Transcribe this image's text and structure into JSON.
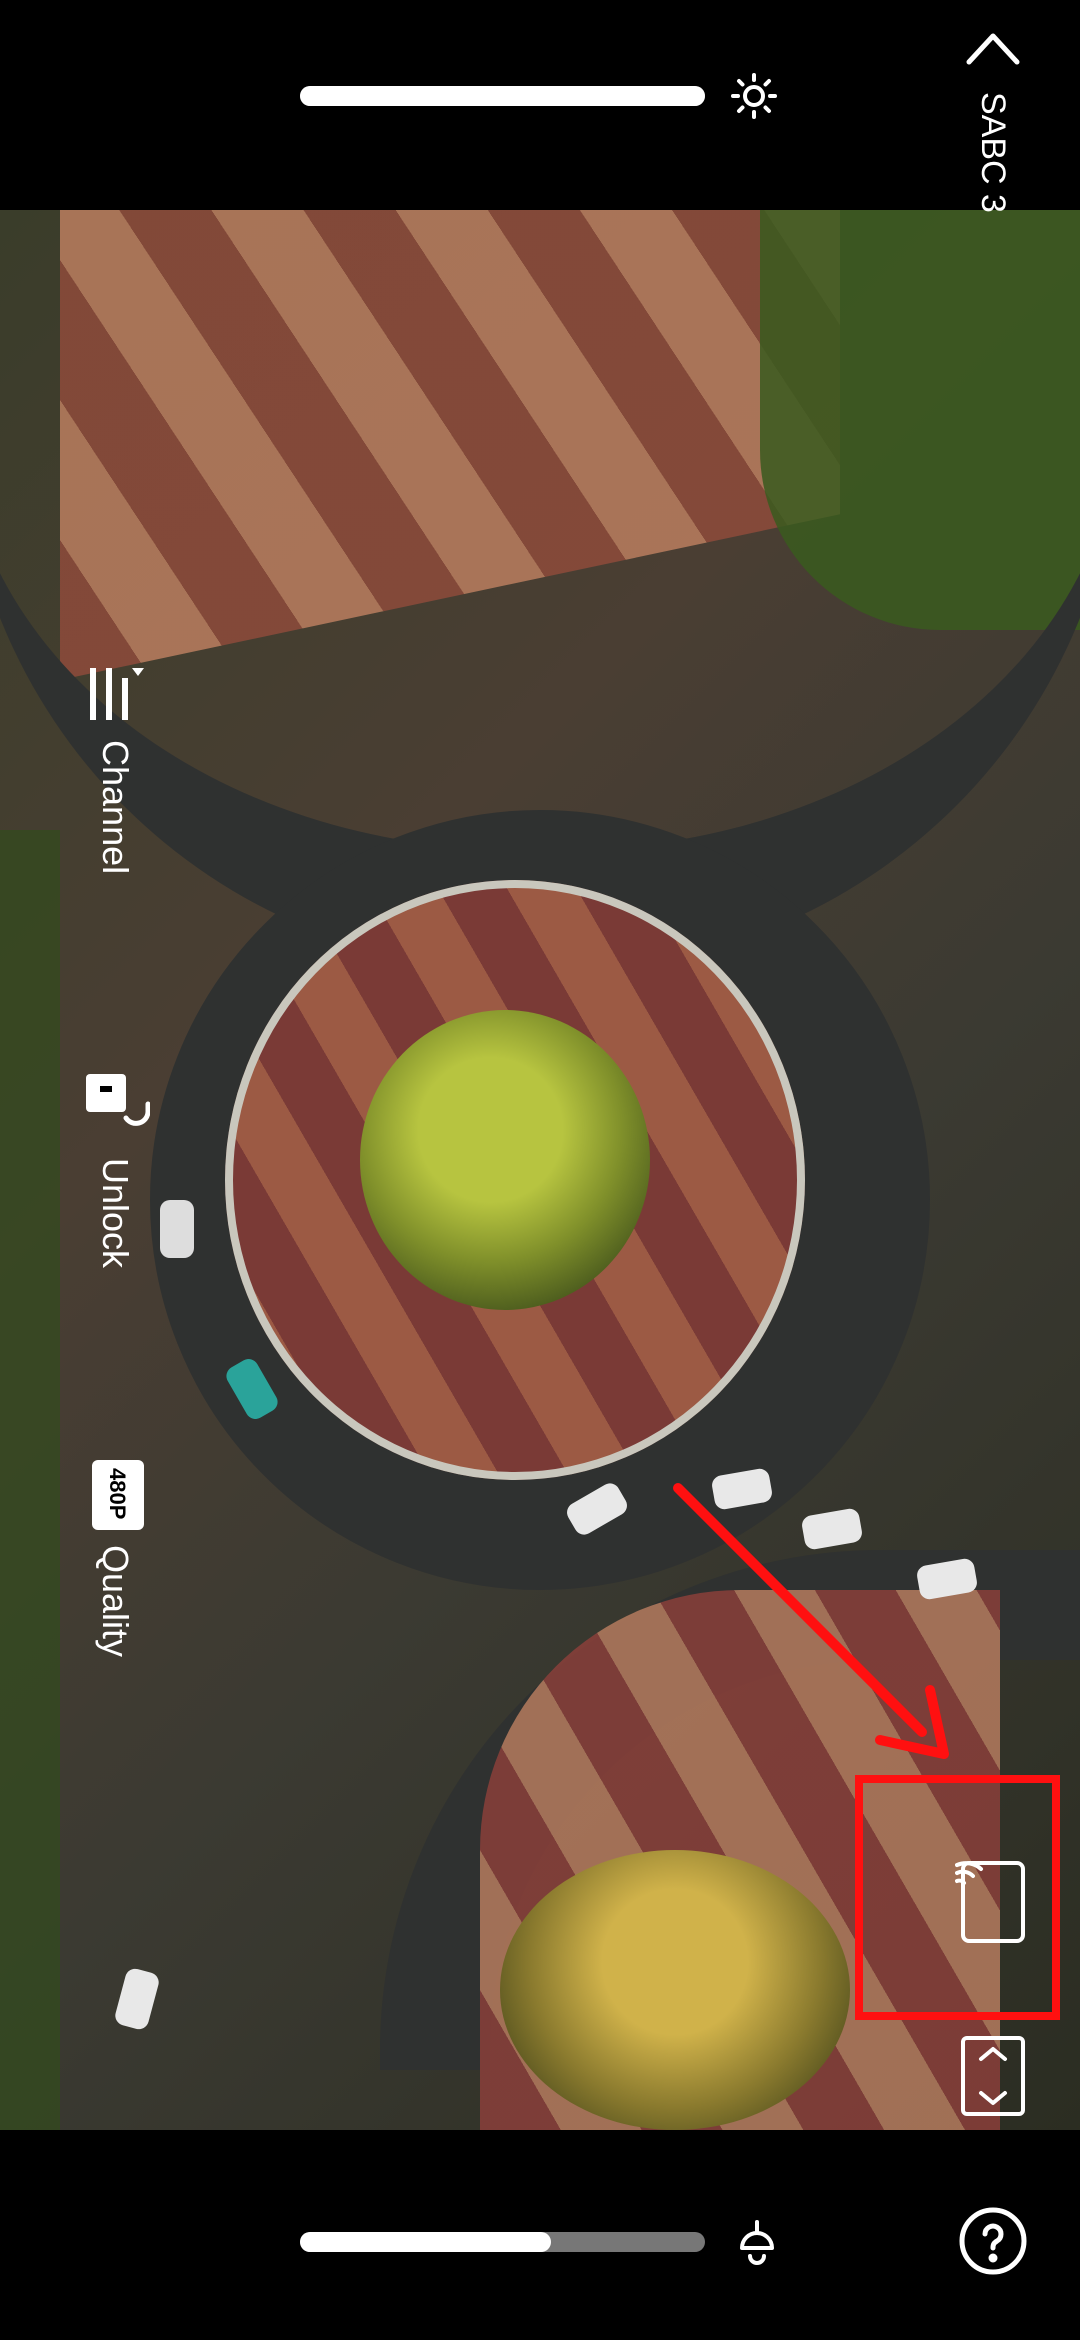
{
  "header": {
    "channel_name": "SABC 3",
    "back_icon": "chevron-up-icon",
    "brightness_icon": "sun-icon",
    "brightness_level": 1.0
  },
  "side_controls": {
    "channel_label": "Channel",
    "unlock_label": "Unlock",
    "quality_label": "Quality",
    "quality_badge": "480P"
  },
  "right_controls": {
    "cast_icon": "cast-icon",
    "aspect_icon": "expand-vertical-icon"
  },
  "footer": {
    "volume_icon": "bell-volume-icon",
    "volume_level": 0.62,
    "help_icon": "help-icon"
  },
  "annotation": {
    "color": "#ff1010"
  }
}
